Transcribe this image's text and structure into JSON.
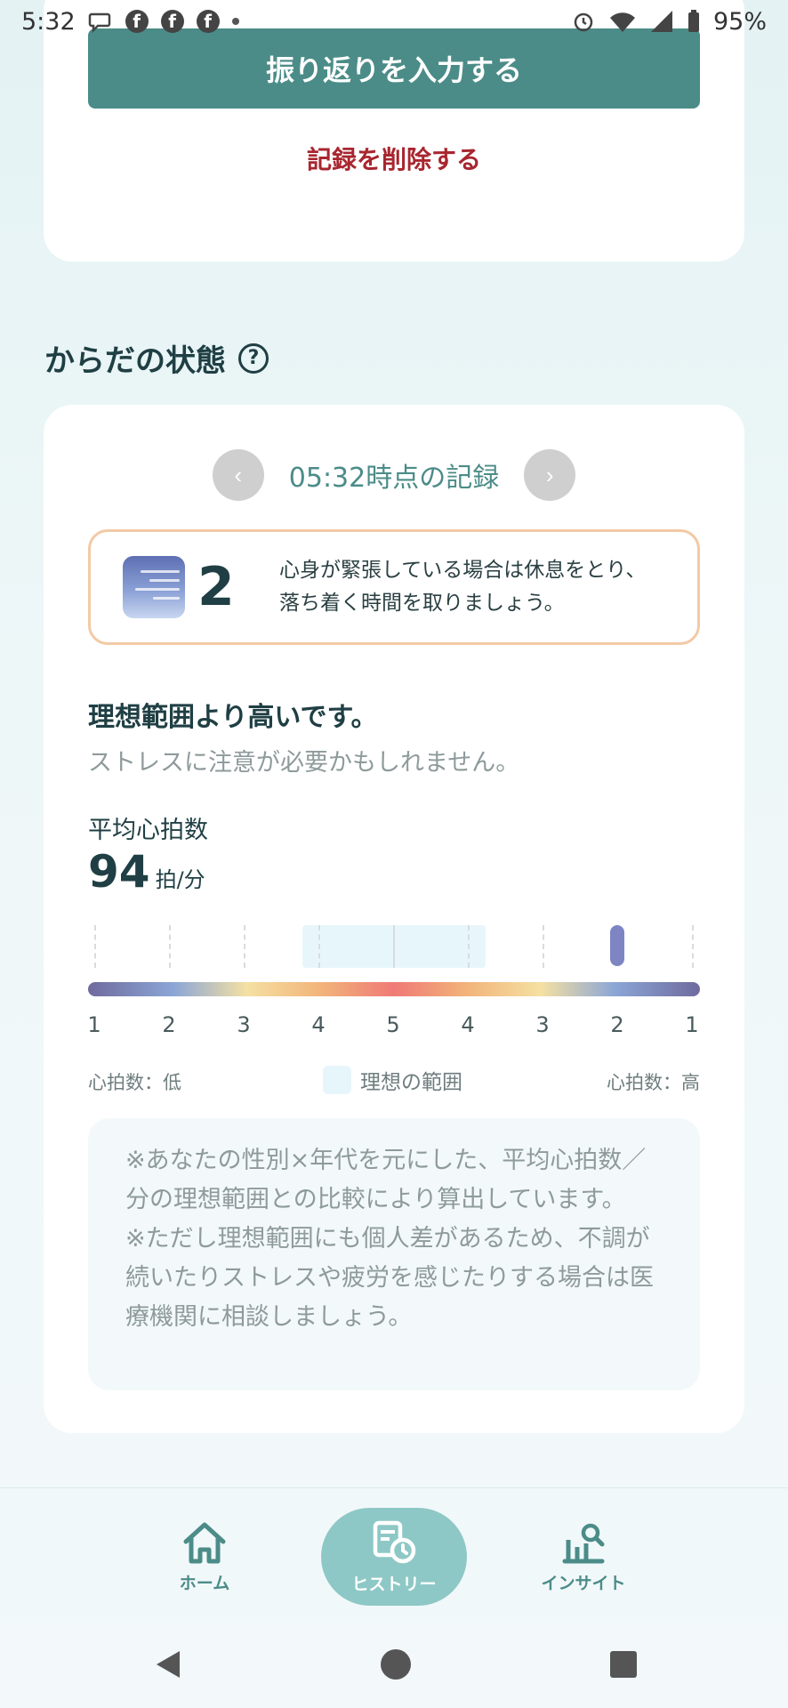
{
  "status_bar": {
    "time": "5:32",
    "battery": "95%"
  },
  "top_card": {
    "reflect_button": "振り返りを入力する",
    "delete_link": "記録を削除する"
  },
  "section": {
    "title": "からだの状態",
    "help_icon": "?"
  },
  "record": {
    "time_label": "05:32時点の記録",
    "prev_icon": "‹",
    "next_icon": "›"
  },
  "level": {
    "number": "2",
    "message_line1": "心身が緊張している場合は休息をとり、",
    "message_line2": "落ち着く時間を取りましょう。"
  },
  "assessment": {
    "heading": "理想範囲より高いです。",
    "sub": "ストレスに注意が必要かもしれません。"
  },
  "heart_rate": {
    "label": "平均心拍数",
    "value": "94",
    "unit": "拍/分",
    "marker_level": "2 (high side)"
  },
  "scale": {
    "labels": [
      "1",
      "2",
      "3",
      "4",
      "5",
      "4",
      "3",
      "2",
      "1"
    ]
  },
  "legend": {
    "low": "心拍数：低",
    "ideal": "理想の範囲",
    "high": "心拍数：高"
  },
  "note": {
    "line1": "※あなたの性別×年代を元にした、平均心拍数／分の理想範囲との比較により算出しています。",
    "line2": "※ただし理想範囲にも個人差があるため、不調が続いたりストレスや疲労を感じたりする場合は医療機関に相談しましょう。"
  },
  "bottom_nav": {
    "home": "ホーム",
    "history": "ヒストリー",
    "insight": "インサイト"
  },
  "colors": {
    "primary": "#4b8c88",
    "danger": "#a8262f",
    "nav_active": "#8ec8c6"
  }
}
